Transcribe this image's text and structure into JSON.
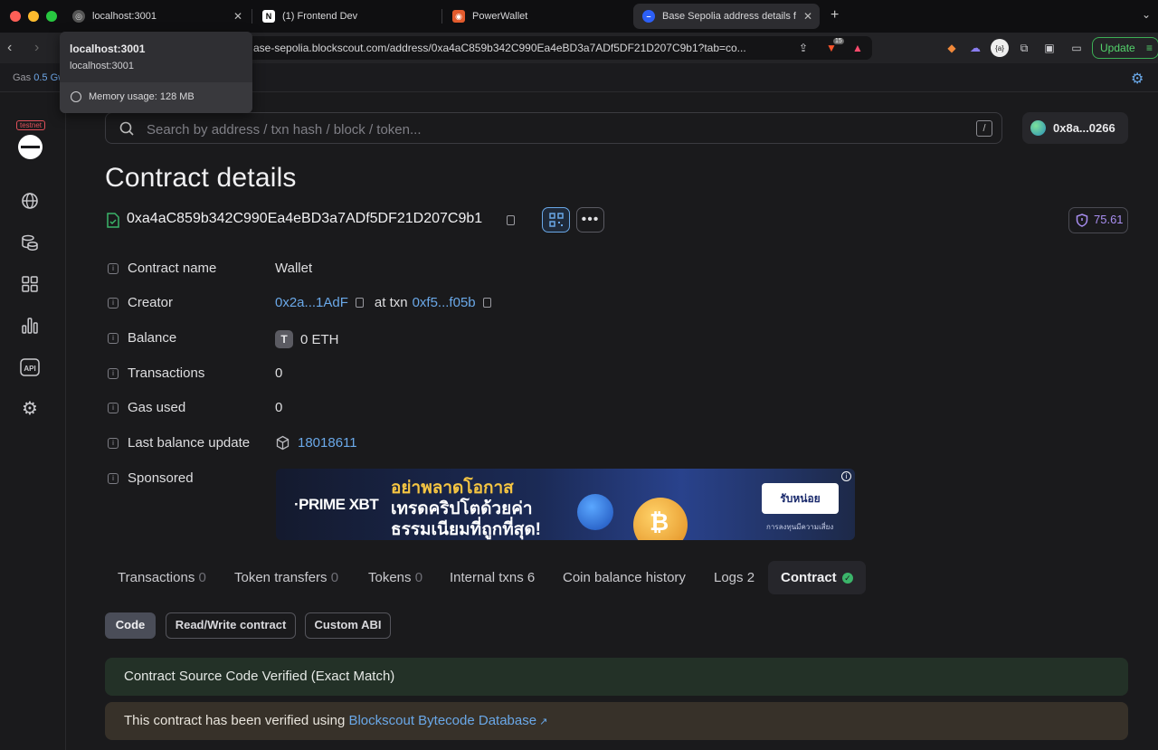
{
  "browser": {
    "tabs": [
      {
        "title": "localhost:3001",
        "active": false
      },
      {
        "title": "(1) Frontend Dev",
        "active": false
      },
      {
        "title": "PowerWallet",
        "active": false
      },
      {
        "title": "Base Sepolia address details f",
        "active": true
      }
    ],
    "url": "ase-sepolia.blockscout.com/address/0xa4aC859b342C990Ea4eBD3a7ADf5DF21D207C9b1?tab=co...",
    "update_label": "Update",
    "brave_badge": "15"
  },
  "tooltip": {
    "title": "localhost:3001",
    "subtitle": "localhost:3001",
    "memory": "Memory usage: 128 MB"
  },
  "gasbar": {
    "label": "Gas",
    "value": "0.5 Gw"
  },
  "sidebar": {
    "badge": "testnet"
  },
  "search": {
    "placeholder": "Search by address / txn hash / block / token...",
    "shortcut": "/"
  },
  "wallet": {
    "label": "0x8a...0266"
  },
  "page": {
    "title": "Contract details",
    "address": "0xa4aC859b342C990Ea4eBD3a7ADf5DF21D207C9b1",
    "score": "75.61"
  },
  "details": {
    "contract_name": {
      "label": "Contract name",
      "value": "Wallet"
    },
    "creator": {
      "label": "Creator",
      "address": "0x2a...1AdF",
      "at_txn": "at txn",
      "txn": "0xf5...f05b"
    },
    "balance": {
      "label": "Balance",
      "token_icon": "T",
      "value": "0 ETH"
    },
    "transactions": {
      "label": "Transactions",
      "value": "0"
    },
    "gas_used": {
      "label": "Gas used",
      "value": "0"
    },
    "last_balance_update": {
      "label": "Last balance update",
      "value": "18018611"
    },
    "sponsored": {
      "label": "Sponsored"
    }
  },
  "ad": {
    "brand": "·PRIME XBT",
    "line1": "อย่าพลาดโอกาส",
    "line2": "เทรดคริปโตด้วยค่า",
    "line3": "ธรรมเนียมที่ถูกที่สุด!",
    "cta": "รับหน่อย",
    "risk": "การลงทุนมีความเสี่ยง",
    "coin_symbol": "₿"
  },
  "content_tabs": [
    {
      "label": "Transactions",
      "count": "0"
    },
    {
      "label": "Token transfers",
      "count": "0"
    },
    {
      "label": "Tokens",
      "count": "0"
    },
    {
      "label": "Internal txns",
      "count": "6"
    },
    {
      "label": "Coin balance history",
      "count": ""
    },
    {
      "label": "Logs",
      "count": "2"
    },
    {
      "label": "Contract",
      "count": ""
    }
  ],
  "sub_tabs": [
    "Code",
    "Read/Write contract",
    "Custom ABI"
  ],
  "alerts": {
    "verified": "Contract Source Code Verified (Exact Match)",
    "using_prefix": "This contract has been verified using ",
    "using_link": "Blockscout Bytecode Database"
  },
  "colors": {
    "accent": "#6aa8e8",
    "success": "#3bb56a",
    "score": "#a88ef0"
  }
}
